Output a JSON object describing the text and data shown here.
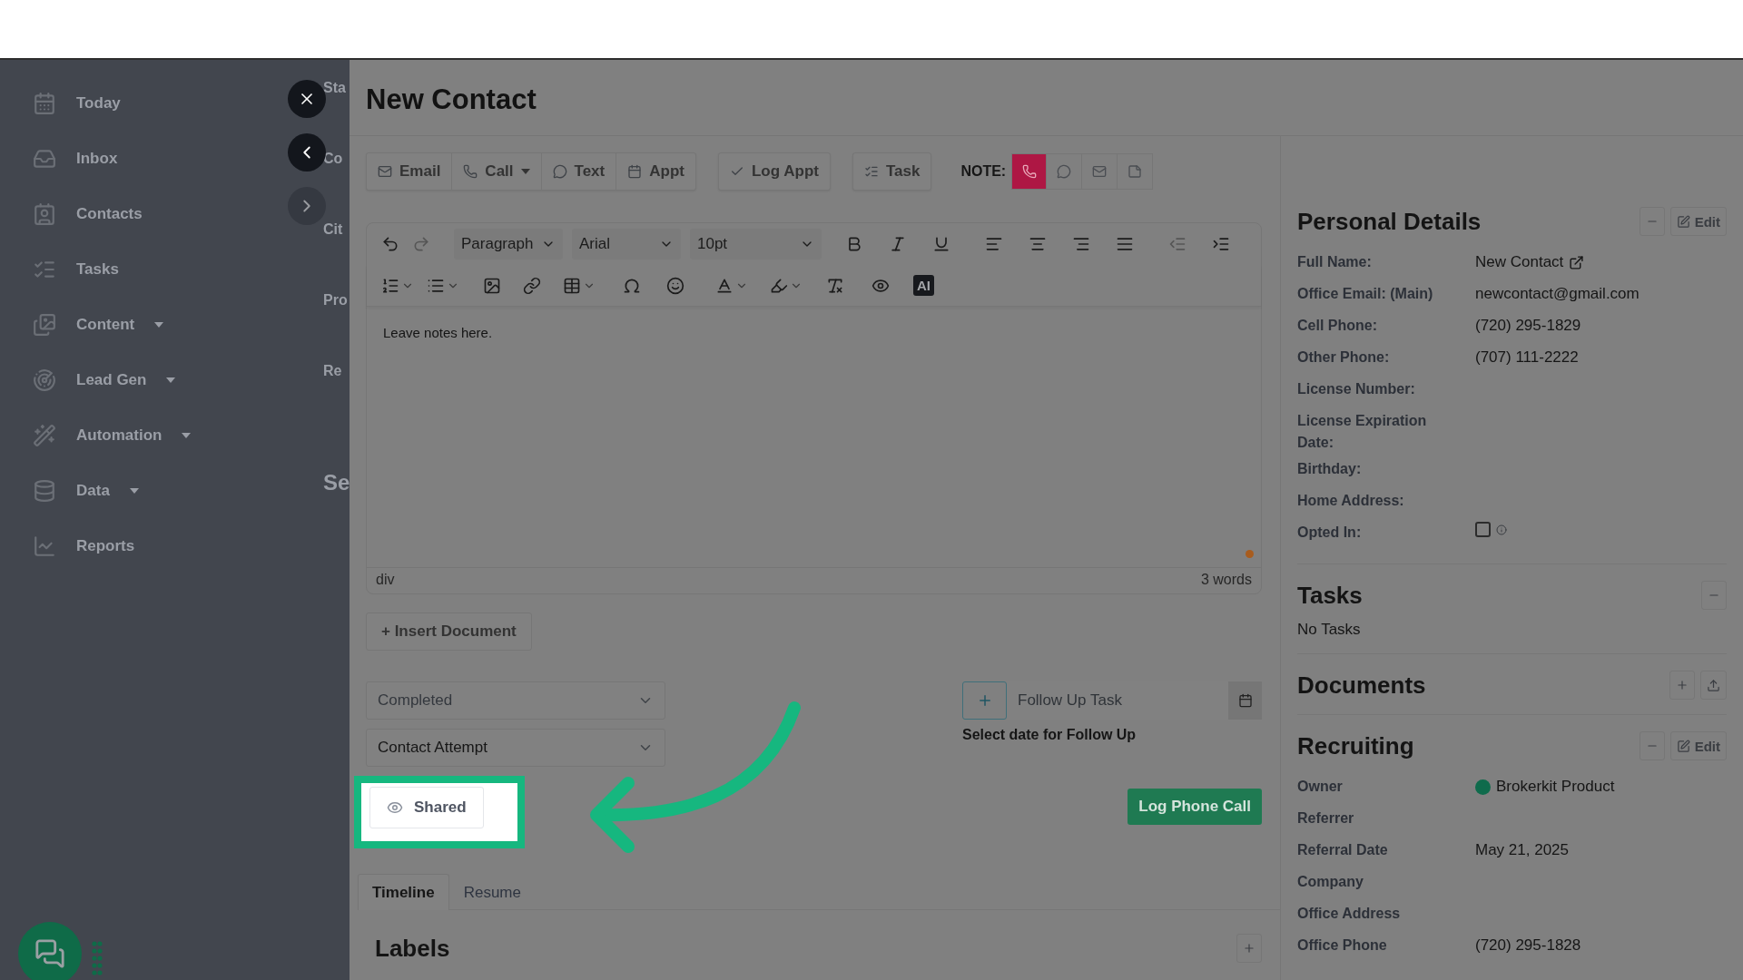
{
  "sidebar": {
    "items": [
      {
        "label": "Today",
        "dropdown": false
      },
      {
        "label": "Inbox",
        "dropdown": false
      },
      {
        "label": "Contacts",
        "dropdown": false
      },
      {
        "label": "Tasks",
        "dropdown": false
      },
      {
        "label": "Content",
        "dropdown": true
      },
      {
        "label": "Lead Gen",
        "dropdown": true
      },
      {
        "label": "Automation",
        "dropdown": true
      },
      {
        "label": "Data",
        "dropdown": true
      },
      {
        "label": "Reports",
        "dropdown": false
      }
    ]
  },
  "background_form": {
    "fragments": [
      "Sta",
      "Co",
      "Cit",
      "Pro",
      "Re"
    ],
    "section": "Se"
  },
  "title": "New Contact",
  "actions": [
    [
      {
        "label": "Email",
        "dropdown": false
      },
      {
        "label": "Call",
        "dropdown": true
      },
      {
        "label": "Text",
        "dropdown": false
      },
      {
        "label": "Appt",
        "dropdown": false
      }
    ],
    [
      {
        "label": "Log Appt",
        "dropdown": false
      }
    ],
    [
      {
        "label": "Task",
        "dropdown": false
      }
    ]
  ],
  "note": {
    "label": "NOTE:",
    "types": [
      {
        "kind": "phone",
        "selected": true
      },
      {
        "kind": "chat",
        "selected": false
      },
      {
        "kind": "mail",
        "selected": false
      },
      {
        "kind": "note",
        "selected": false
      }
    ]
  },
  "editor": {
    "block_format": "Paragraph",
    "font": "Arial",
    "font_size": "10pt",
    "ai_button": "AI",
    "content": "Leave notes here.",
    "path": "div",
    "word_count": "3 words"
  },
  "insert_document": "+ Insert Document",
  "selects": [
    {
      "value": "Completed",
      "disabled": true
    },
    {
      "value": "Contact Attempt",
      "disabled": false
    }
  ],
  "visibility_button": {
    "label": "Shared"
  },
  "follow_up": {
    "placeholder": "Follow Up Task",
    "hint": "Select date for Follow Up"
  },
  "submit": "Log Phone Call",
  "tabs": [
    {
      "label": "Timeline",
      "selected": true
    },
    {
      "label": "Resume",
      "selected": false
    }
  ],
  "labels_section": {
    "title": "Labels"
  },
  "personal_details": {
    "title": "Personal Details",
    "edit": "Edit",
    "fields": [
      {
        "label": "Full Name:",
        "value": "New Contact",
        "kind": "link"
      },
      {
        "label": "Office Email: (Main)",
        "value": "newcontact@gmail.com",
        "kind": "text"
      },
      {
        "label": "Cell Phone:",
        "value": "(720) 295-1829",
        "kind": "text"
      },
      {
        "label": "Other Phone:",
        "value": "(707) 111-2222",
        "kind": "text"
      },
      {
        "label": "License Number:",
        "kind": "text"
      },
      {
        "label": "License Expiration Date:",
        "kind": "text"
      },
      {
        "label": "Birthday:",
        "kind": "text"
      },
      {
        "label": "Home Address:",
        "kind": "text"
      },
      {
        "label": "Opted In:",
        "kind": "checkbox",
        "checked": false
      }
    ]
  },
  "tasks": {
    "title": "Tasks",
    "empty": "No Tasks"
  },
  "documents": {
    "title": "Documents"
  },
  "recruiting": {
    "title": "Recruiting",
    "edit": "Edit",
    "fields": [
      {
        "label": "Owner",
        "value": "Brokerkit Product",
        "kind": "avatar"
      },
      {
        "label": "Referrer",
        "kind": "text"
      },
      {
        "label": "Referral Date",
        "value": "May 21, 2025",
        "kind": "text"
      },
      {
        "label": "Company",
        "kind": "text"
      },
      {
        "label": "Office Address",
        "kind": "text"
      },
      {
        "label": "Office Phone",
        "value": "(720) 295-1828",
        "kind": "text"
      }
    ]
  }
}
